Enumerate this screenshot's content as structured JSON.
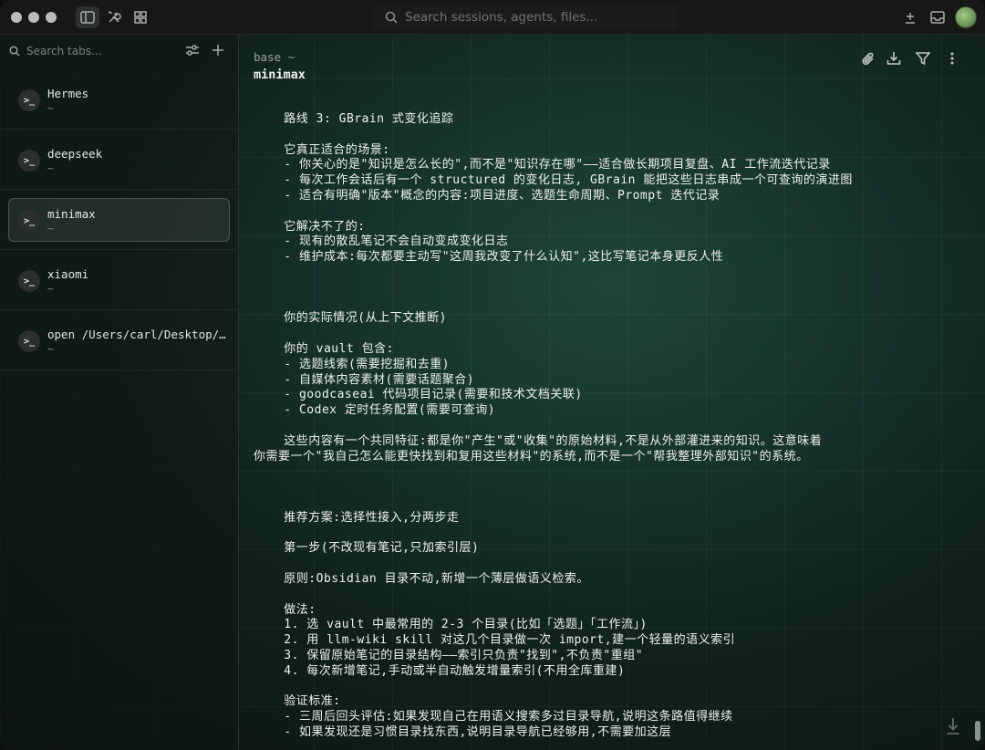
{
  "titlebar": {
    "search_placeholder": "Search sessions, agents, files..."
  },
  "sidebar": {
    "search_placeholder": "Search tabs...",
    "items": [
      {
        "label": "Hermes",
        "sub": "~",
        "icon": ">_"
      },
      {
        "label": "deepseek",
        "sub": "~",
        "icon": ">_"
      },
      {
        "label": "minimax",
        "sub": "~",
        "icon": ">_",
        "selected": true
      },
      {
        "label": "xiaomi",
        "sub": "~",
        "icon": ">_"
      },
      {
        "label": "open /Users/carl/Desktop/...",
        "sub": "~",
        "icon": ">_"
      }
    ]
  },
  "main": {
    "breadcrumb": "base ~",
    "session_name": "minimax",
    "lines": [
      "    路线 3: GBrain 式变化追踪",
      "",
      "    它真正适合的场景:",
      "    - 你关心的是\"知识是怎么长的\",而不是\"知识存在哪\"——适合做长期项目复盘、AI 工作流迭代记录",
      "    - 每次工作会话后有一个 structured 的变化日志, GBrain 能把这些日志串成一个可查询的演进图",
      "    - 适合有明确\"版本\"概念的内容:项目进度、选题生命周期、Prompt 迭代记录",
      "",
      "    它解决不了的:",
      "    - 现有的散乱笔记不会自动变成变化日志",
      "    - 维护成本:每次都要主动写\"这周我改变了什么认知\",这比写笔记本身更反人性",
      "",
      "",
      "",
      "    你的实际情况(从上下文推断)",
      "",
      "    你的 vault 包含:",
      "    - 选题线索(需要挖掘和去重)",
      "    - 自媒体内容素材(需要话题聚合)",
      "    - goodcaseai 代码项目记录(需要和技术文档关联)",
      "    - Codex 定时任务配置(需要可查询)",
      "",
      "    这些内容有一个共同特征:都是你\"产生\"或\"收集\"的原始材料,不是从外部灌进来的知识。这意味着",
      "你需要一个\"我自己怎么能更快找到和复用这些材料\"的系统,而不是一个\"帮我整理外部知识\"的系统。",
      "",
      "",
      "",
      "    推荐方案:选择性接入,分两步走",
      "",
      "    第一步(不改现有笔记,只加索引层)",
      "",
      "    原则:Obsidian 目录不动,新增一个薄层做语义检索。",
      "",
      "    做法:",
      "    1. 选 vault 中最常用的 2-3 个目录(比如「选题」「工作流」)",
      "    2. 用 llm-wiki skill 对这几个目录做一次 import,建一个轻量的语义索引",
      "    3. 保留原始笔记的目录结构——索引只负责\"找到\",不负责\"重组\"",
      "    4. 每次新增笔记,手动或半自动触发增量索引(不用全库重建)",
      "",
      "    验证标准:",
      "    - 三周后回头评估:如果发现自己在用语义搜索多过目录导航,说明这条路值得继续",
      "    - 如果发现还是习惯目录找东西,说明目录导航已经够用,不需要加这层"
    ]
  }
}
